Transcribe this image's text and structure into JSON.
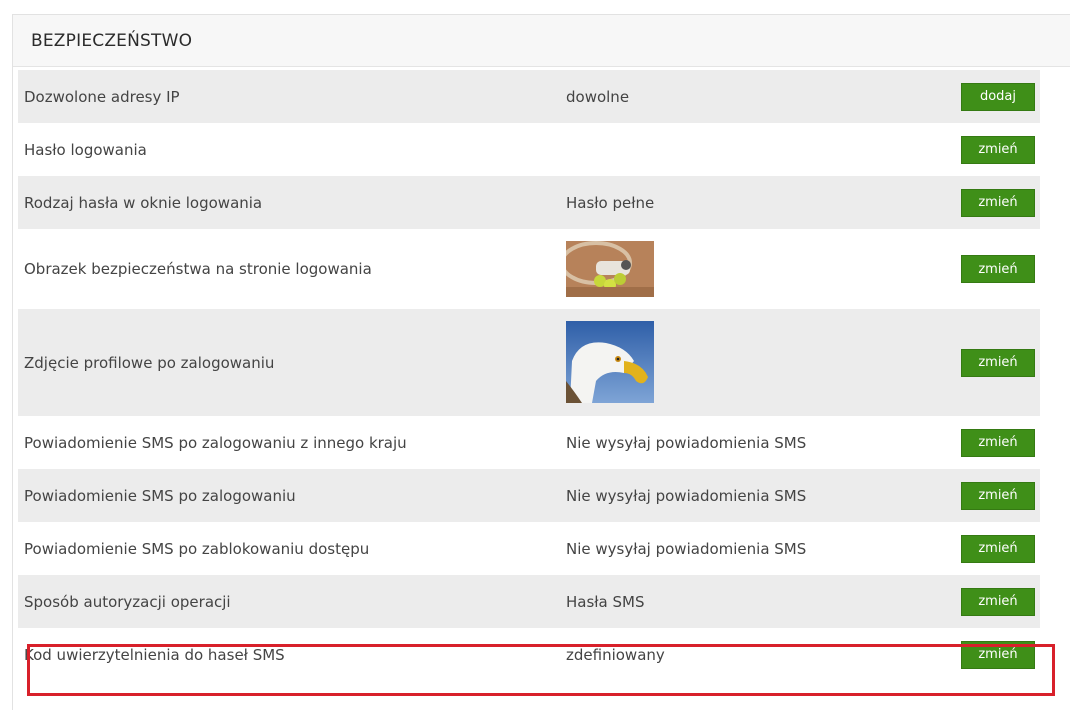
{
  "panel": {
    "title": "BEZPIECZEŃSTWO"
  },
  "rows": [
    {
      "label": "Dozwolone adresy IP",
      "value": "dowolne",
      "button": "dodaj"
    },
    {
      "label": "Hasło logowania",
      "value": "",
      "button": "zmień"
    },
    {
      "label": "Rodzaj hasła w oknie logowania",
      "value": "Hasło pełne",
      "button": "zmień"
    },
    {
      "label": "Obrazek bezpieczeństwa na stronie logowania",
      "image": "tennis-balls-thumbnail",
      "button": "zmień"
    },
    {
      "label": "Zdjęcie profilowe po zalogowaniu",
      "image": "eagle-thumbnail",
      "button": "zmień"
    },
    {
      "label": "Powiadomienie SMS po zalogowaniu z innego kraju",
      "value": "Nie wysyłaj powiadomienia SMS",
      "button": "zmień"
    },
    {
      "label": "Powiadomienie SMS po zalogowaniu",
      "value": "Nie wysyłaj powiadomienia SMS",
      "button": "zmień"
    },
    {
      "label": "Powiadomienie SMS po zablokowaniu dostępu",
      "value": "Nie wysyłaj powiadomienia SMS",
      "button": "zmień"
    },
    {
      "label": "Sposób autoryzacji operacji",
      "value": "Hasła SMS",
      "button": "zmień"
    },
    {
      "label": "Kod uwierzytelnienia do haseł SMS",
      "value": "zdefiniowany",
      "button": "zmień"
    }
  ],
  "colors": {
    "button": "#3f8f18",
    "highlight": "#d8202a",
    "row_shaded": "#ececec"
  }
}
